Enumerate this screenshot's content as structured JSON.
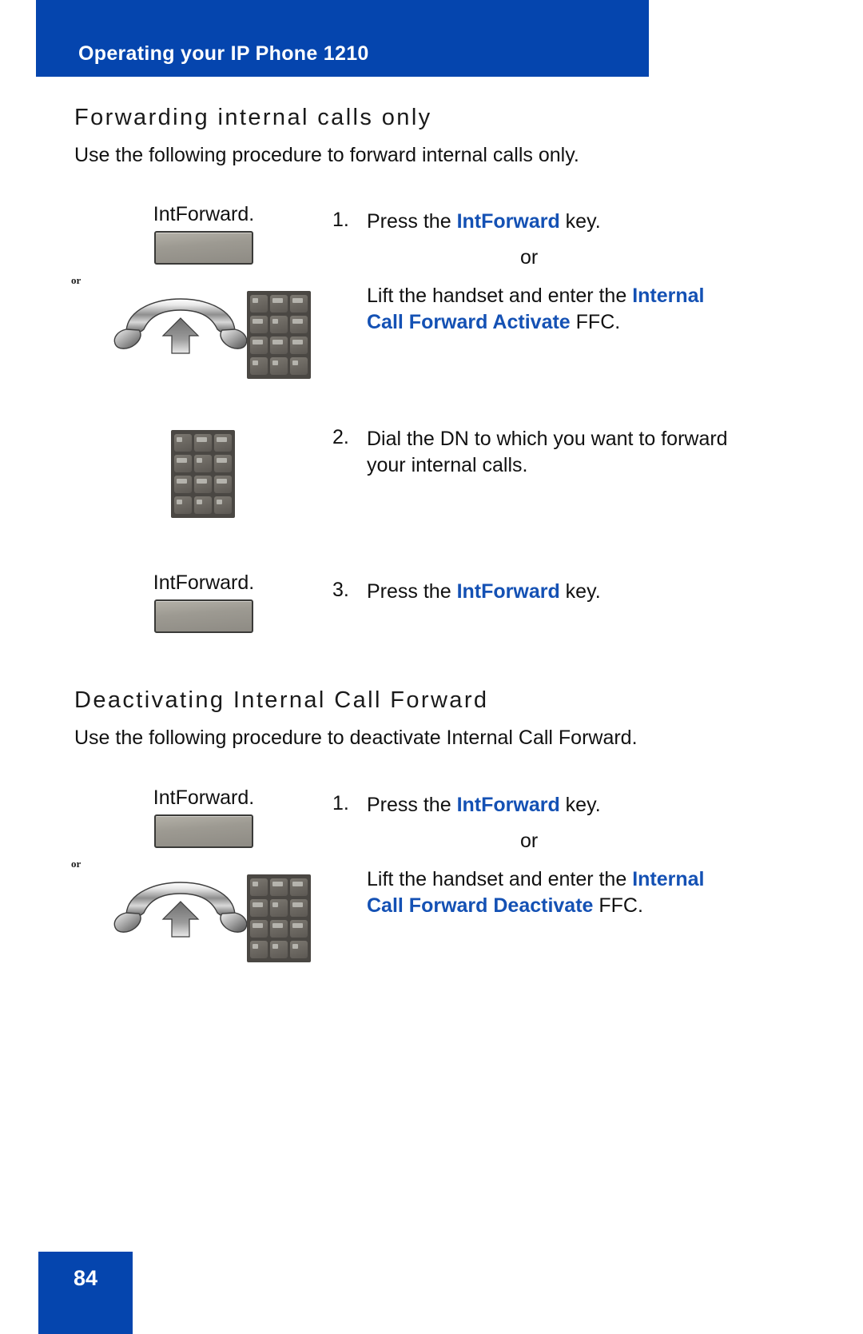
{
  "document": {
    "header_title": "Operating your IP Phone 1210",
    "page_number": "84",
    "accent_color": "#0545ae",
    "highlight_color": "#1451b4"
  },
  "sections": [
    {
      "heading": "Forwarding internal calls only",
      "intro": "Use the following procedure to forward internal calls only.",
      "steps": [
        {
          "number": "1.",
          "text_before": "Press the ",
          "text_highlight": "IntForward",
          "text_after": " key.",
          "or_label": "or",
          "alt_line1_before": "Lift the handset and enter the ",
          "alt_line1_highlight": "Internal",
          "alt_line2_highlight": "Call Forward Activate",
          "alt_line2_after": " FFC.",
          "art_softkey_label": "IntForward.",
          "art_or_small": "or"
        },
        {
          "number": "2.",
          "text_line1": "Dial the DN to which you want to forward",
          "text_line2": "your internal calls."
        },
        {
          "number": "3.",
          "text_before": "Press the ",
          "text_highlight": "IntForward",
          "text_after": " key.",
          "art_softkey_label": "IntForward."
        }
      ]
    },
    {
      "heading": "Deactivating Internal Call Forward",
      "intro": "Use the following procedure to deactivate Internal Call Forward.",
      "steps": [
        {
          "number": "1.",
          "text_before": "Press the ",
          "text_highlight": "IntForward",
          "text_after": " key.",
          "or_label": "or",
          "alt_line1_before": "Lift the handset and enter the ",
          "alt_line1_highlight": "Internal",
          "alt_line2_highlight": "Call Forward Deactivate",
          "alt_line2_after": " FFC.",
          "art_softkey_label": "IntForward.",
          "art_or_small": "or"
        }
      ]
    }
  ],
  "icons": {
    "handset": "handset-lift-icon",
    "keypad": "dial-keypad-icon",
    "softkey": "softkey-button-icon",
    "arrow_up": "arrow-up-icon"
  }
}
